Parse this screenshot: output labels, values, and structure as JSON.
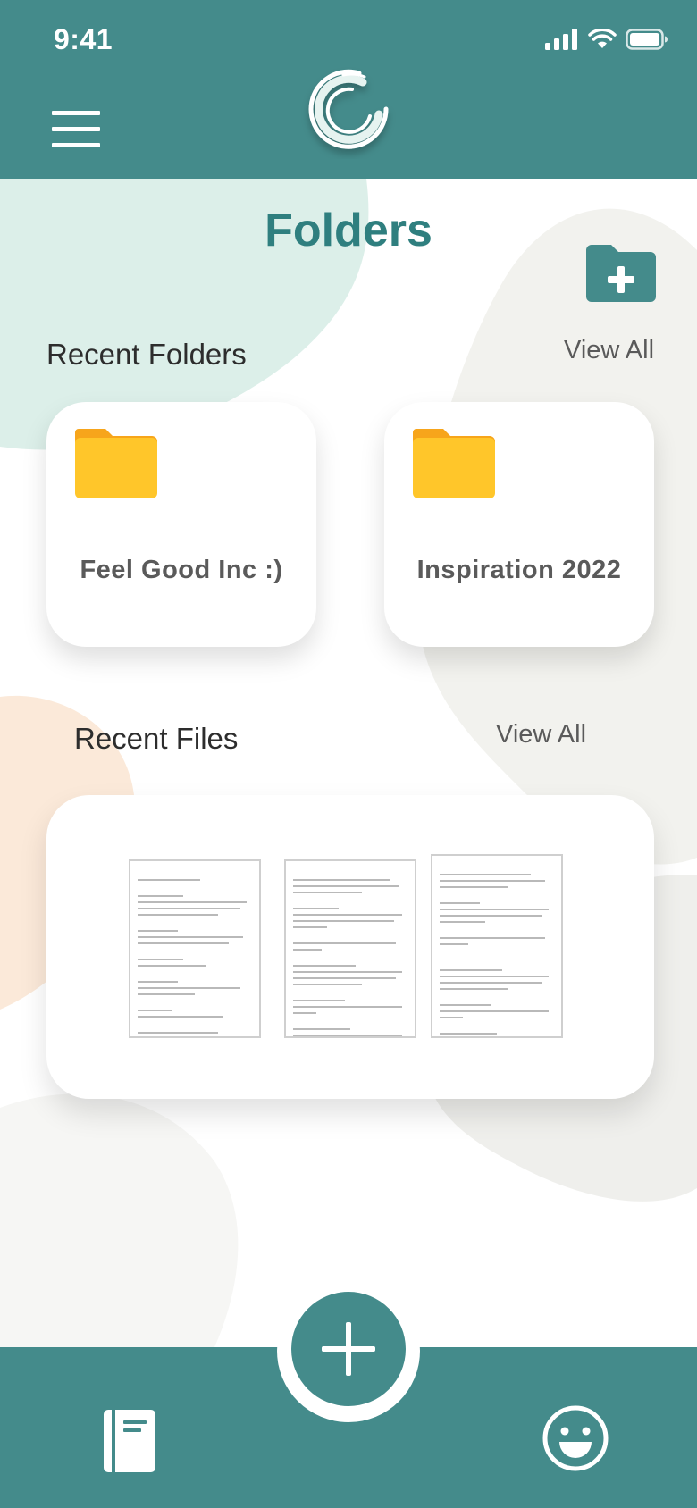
{
  "status_bar": {
    "time": "9:41"
  },
  "header": {
    "menu_icon": "hamburger-menu-icon",
    "logo": "app-logo-swirl"
  },
  "page": {
    "title": "Folders",
    "new_folder_icon": "folder-add-icon"
  },
  "recent_folders": {
    "label": "Recent Folders",
    "view_all": "View All",
    "items": [
      {
        "name": "Feel Good Inc :)",
        "icon": "folder-icon",
        "color": "#ffc62a"
      },
      {
        "name": "Inspiration 2022",
        "icon": "folder-icon",
        "color": "#ffc62a"
      }
    ]
  },
  "recent_files": {
    "label": "Recent Files",
    "view_all": "View All",
    "thumbnails": [
      {
        "icon": "document-thumbnail"
      },
      {
        "icon": "document-thumbnail"
      },
      {
        "icon": "document-thumbnail"
      }
    ]
  },
  "tab_bar": {
    "left_icon": "notebook-icon",
    "center_icon": "plus-icon",
    "right_icon": "smiley-icon"
  },
  "colors": {
    "primary": "#448b8b",
    "title": "#2f7f7f",
    "folder": "#ffc62a",
    "folder_tab": "#f7a51b",
    "blob_mint": "#dcefe9",
    "blob_peach": "#fbe9d9",
    "blob_gray": "#f1f1ef"
  }
}
